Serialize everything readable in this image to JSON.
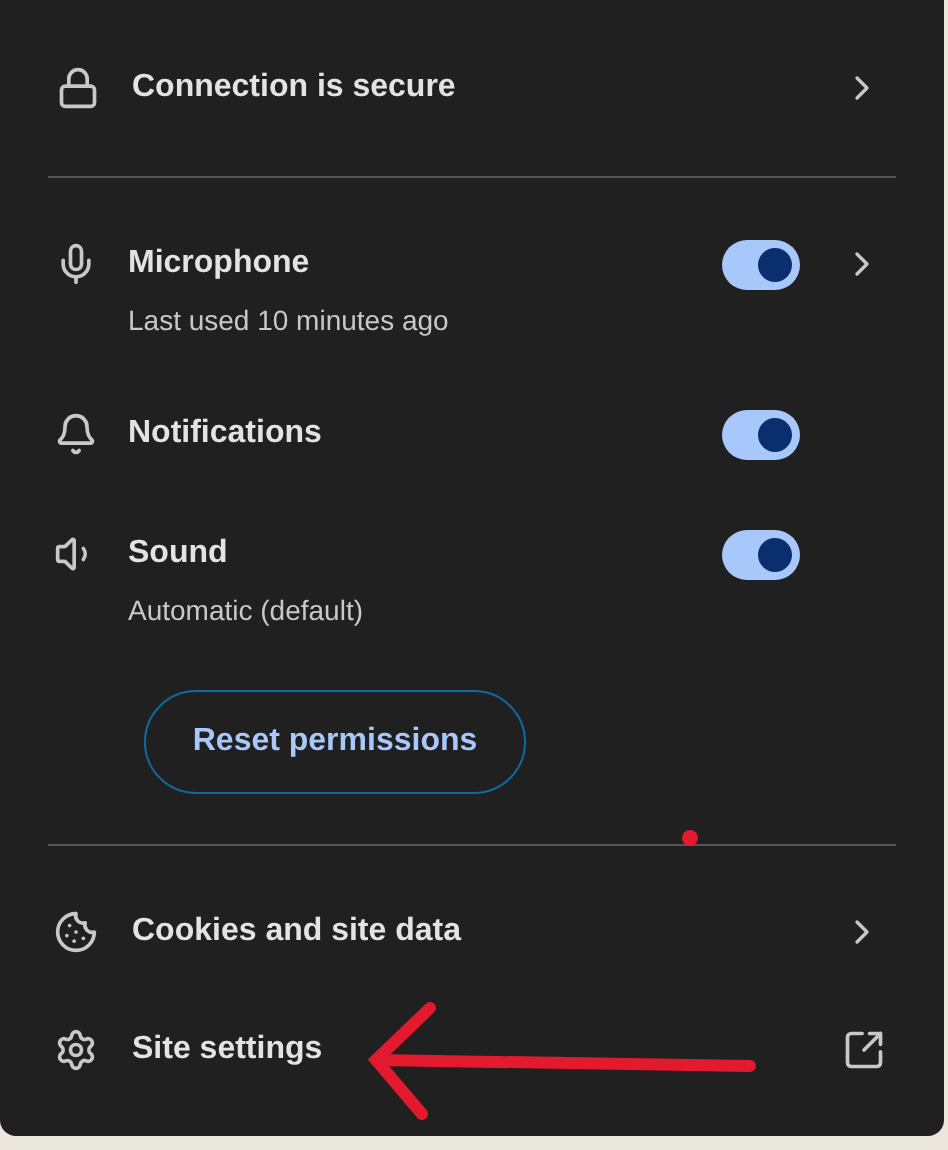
{
  "connection": {
    "label": "Connection is secure"
  },
  "permissions": [
    {
      "kind": "microphone",
      "label": "Microphone",
      "subtitle": "Last used 10 minutes ago",
      "on": true,
      "expandable": true
    },
    {
      "kind": "notifications",
      "label": "Notifications",
      "on": true,
      "expandable": false
    },
    {
      "kind": "sound",
      "label": "Sound",
      "subtitle": "Automatic (default)",
      "on": true,
      "expandable": false
    }
  ],
  "reset_button": "Reset permissions",
  "links": [
    {
      "kind": "cookies",
      "label": "Cookies and site data",
      "external": false
    },
    {
      "kind": "settings",
      "label": "Site settings",
      "external": true
    }
  ]
}
